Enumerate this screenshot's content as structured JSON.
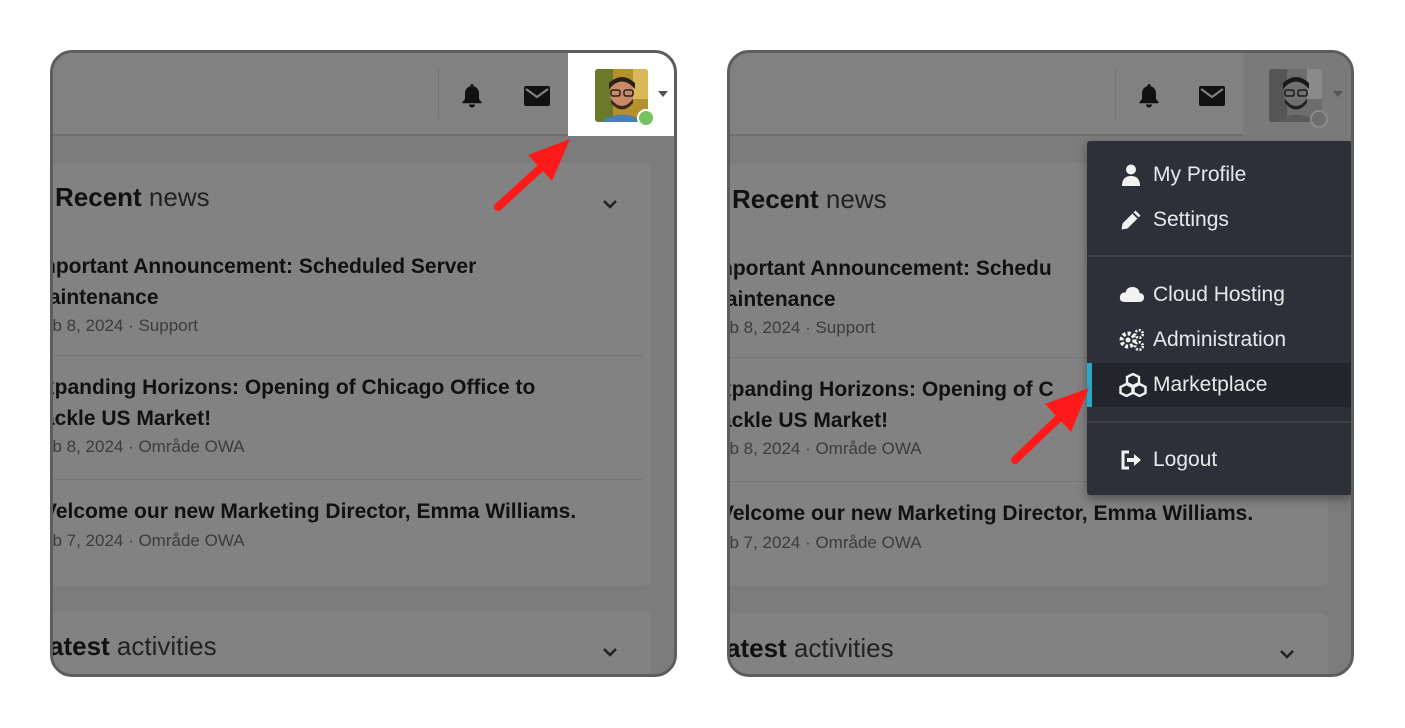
{
  "left": {
    "recent_news": {
      "title_bold": "Recent",
      "title_rest": " news",
      "items": [
        {
          "title_line1": "nportant Announcement: Scheduled Server",
          "title_line2": "laintenance",
          "meta": "eb 8, 2024 · Support"
        },
        {
          "title_line1": "xpanding Horizons: Opening of Chicago Office to",
          "title_line2": "ackle US Market!",
          "meta": "eb 8, 2024 · Område OWA"
        },
        {
          "title_line1": "Velcome our new Marketing Director, Emma Williams.",
          "title_line2": "",
          "meta": "eb 7, 2024 · Område OWA"
        }
      ]
    },
    "latest_activities": {
      "title_bold": "atest",
      "title_rest": " activities"
    }
  },
  "right": {
    "recent_news": {
      "title_bold": "Recent",
      "title_rest": " news",
      "items": [
        {
          "title_line1": "nportant Announcement: Schedu",
          "title_line2": "laintenance",
          "meta": "eb 8, 2024 · Support"
        },
        {
          "title_line1": "xpanding Horizons: Opening of C",
          "title_line2": "ackle US Market!",
          "meta": "eb 8, 2024 · Område OWA"
        },
        {
          "title_line1": "Velcome our new Marketing Director, Emma Williams.",
          "title_line2": "",
          "meta": "eb 7, 2024 · Område OWA"
        }
      ]
    },
    "latest_activities": {
      "title_bold": "atest",
      "title_rest": " activities"
    },
    "user_menu": {
      "items": [
        {
          "label": "My Profile",
          "icon": "user-icon"
        },
        {
          "label": "Settings",
          "icon": "pencil-icon"
        },
        {
          "label": "Cloud Hosting",
          "icon": "cloud-icon"
        },
        {
          "label": "Administration",
          "icon": "cogs-icon"
        },
        {
          "label": "Marketplace",
          "icon": "cubes-icon",
          "active": true
        },
        {
          "label": "Logout",
          "icon": "sign-out-icon"
        }
      ]
    }
  },
  "colors": {
    "overlay": "#7c7c7c",
    "dropdown_bg": "#2d3038",
    "active_indicator": "#27a8c9",
    "status_online": "#74c35c",
    "status_offline": "#6e6e6e",
    "arrow": "#ff1a1a"
  }
}
